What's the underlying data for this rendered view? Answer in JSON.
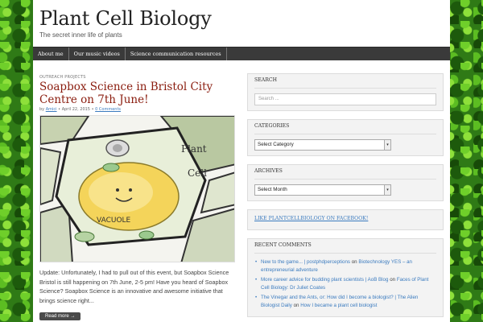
{
  "site": {
    "title": "Plant Cell Biology",
    "description": "The secret inner life of plants"
  },
  "nav": {
    "items": [
      {
        "label": "About me"
      },
      {
        "label": "Our music videos"
      },
      {
        "label": "Science communication resources"
      }
    ]
  },
  "post": {
    "category": "OUTREACH PROJECTS",
    "title": "Soapbox Science in Bristol City Centre on 7th June!",
    "meta_by": "by",
    "author": "Amici",
    "date": "April 22, 2015",
    "comments_link": "0 Comments",
    "image_text_plant": "Plant",
    "image_text_cell": "Cell",
    "image_text_vacuole": "VACUOLE",
    "excerpt": "Update: Unfortunately, I had to pull out of this event, but Soapbox Science Bristol is still happening on 7th June, 2-5 pm! Have you heard of Soapbox Science? Soapbox Science is an innovative and awesome initiative that brings science right...",
    "read_more": "Read more →"
  },
  "sidebar": {
    "search": {
      "title": "SEARCH",
      "placeholder": "Search ..."
    },
    "categories": {
      "title": "CATEGORIES",
      "selected": "Select Category"
    },
    "archives": {
      "title": "ARCHIVES",
      "selected": "Select Month"
    },
    "facebook": {
      "label": "LIKE PLANTCELLBIOLOGY ON FACEBOOK!"
    },
    "recent_comments": {
      "title": "RECENT COMMENTS",
      "items": [
        {
          "author": "New to the game... | postphdperceptions",
          "on": "on",
          "post": "Biotechnology YES – an entrepreneurial adventure"
        },
        {
          "author": "More career advice for budding plant scientists | AoB Blog",
          "on": "on",
          "post": "Faces of Plant Cell Biology: Dr Juliet Coates"
        },
        {
          "author": "The Vinegar and the Ants, or: How did I become a biologist? | The Alien Biologist Daily",
          "on": "on",
          "post": "How I became a plant cell biologist"
        }
      ]
    }
  }
}
